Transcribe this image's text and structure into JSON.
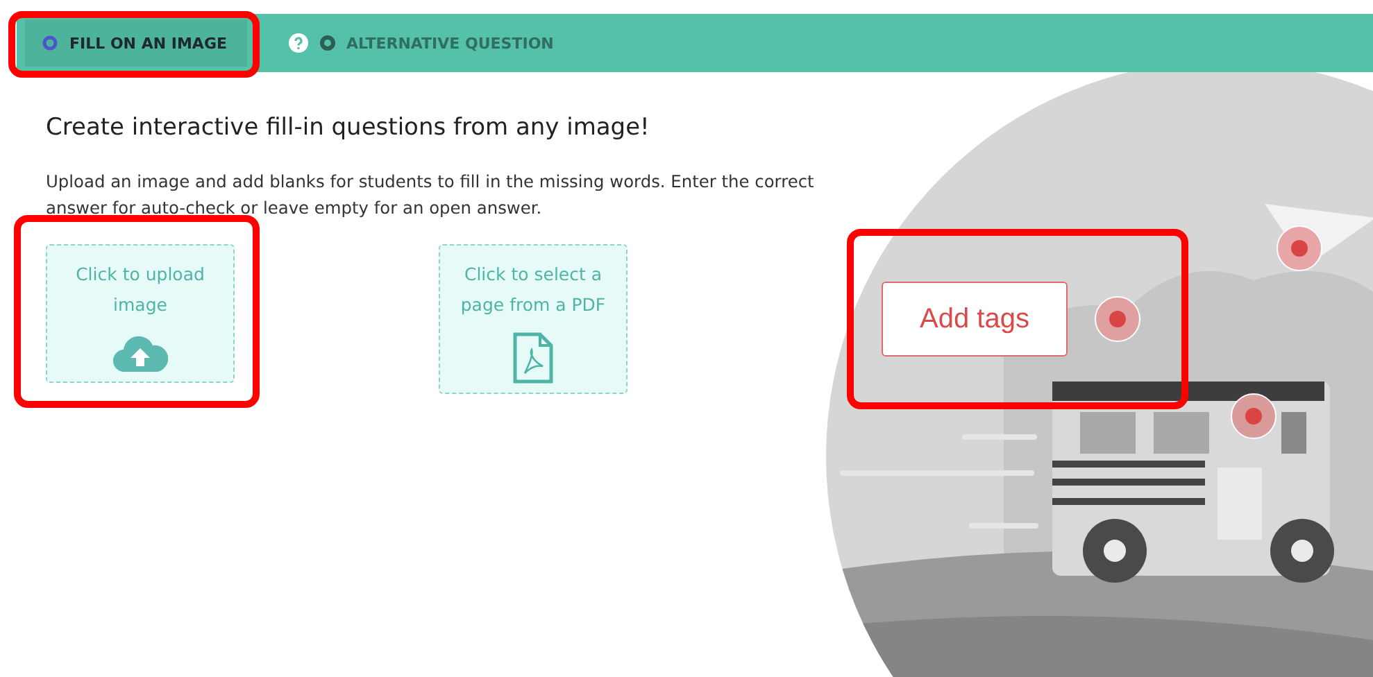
{
  "tabs": [
    {
      "label": "FILL ON AN IMAGE",
      "selected": true,
      "highlighted": true,
      "kind": "ring"
    },
    {
      "label": "ALTERNATIVE QUESTION",
      "selected": false,
      "highlighted": false,
      "kind": "help"
    }
  ],
  "heading": "Create interactive fill-in questions from any image!",
  "description": "Upload an image and add blanks for students to fill in the missing words. Enter the correct answer for auto-check or leave empty for an open answer.",
  "upload_options": [
    {
      "label": "Click to upload image",
      "kind": "cloud",
      "highlighted": true
    },
    {
      "label": "Click to select a page from a PDF",
      "kind": "pdf",
      "highlighted": false
    }
  ],
  "illustration": {
    "callout": "Add tags",
    "highlighted": true
  }
}
